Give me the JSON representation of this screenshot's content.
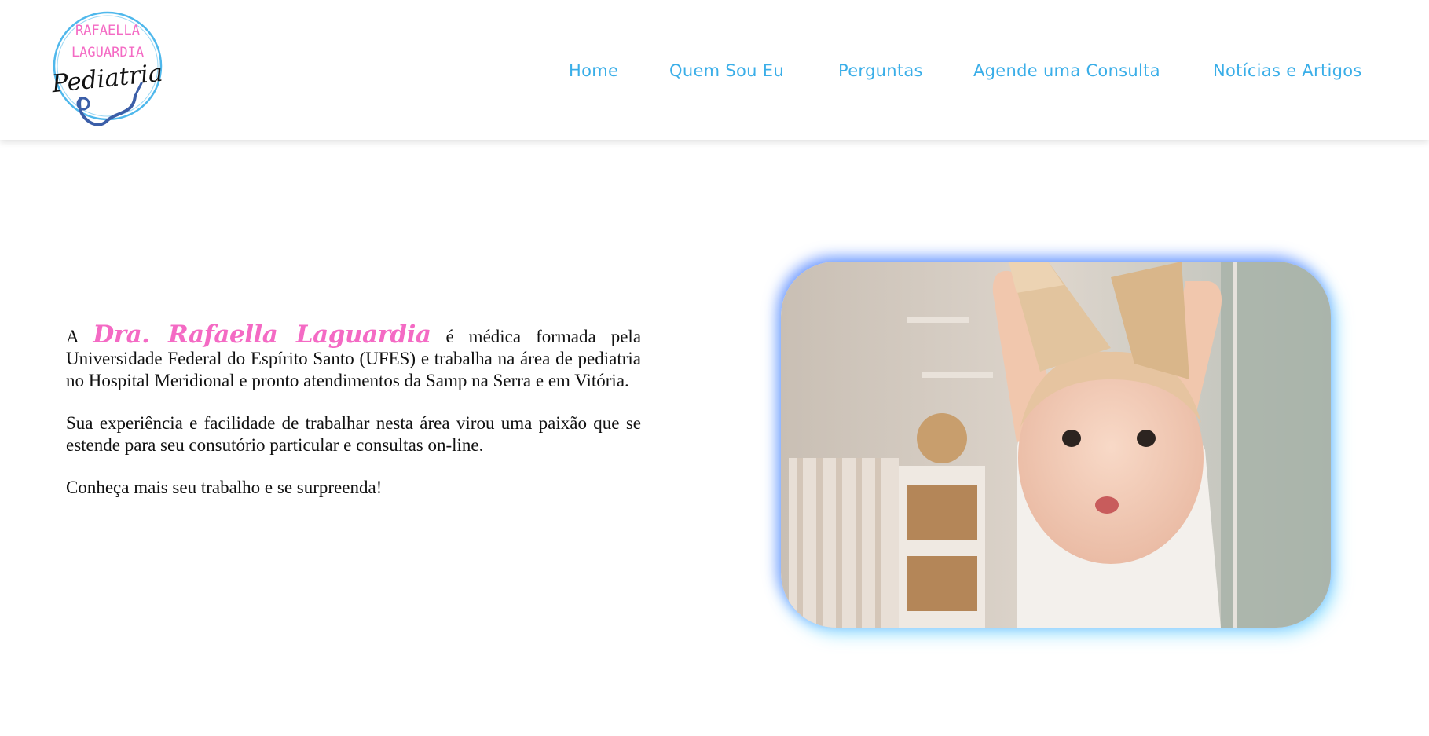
{
  "header": {
    "logo": {
      "line1": "RAFAELLA",
      "line2": "LAGUARDIA",
      "line3": "Pediatria"
    },
    "nav": [
      {
        "label": "Home"
      },
      {
        "label": "Quem Sou Eu"
      },
      {
        "label": "Perguntas"
      },
      {
        "label": "Agende uma Consulta"
      },
      {
        "label": "Notícias e Artigos"
      }
    ]
  },
  "intro": {
    "p1_prefix": "A",
    "p1_name": "Dra. Rafaella Laguardia",
    "p1_rest": "é médica formada pela Universidade Federal do Espírito Santo (UFES) e trabalha na área de pediatria no Hospital Meridional e pronto atendimentos da Samp na Serra e em Vitória.",
    "p2": "Sua experiência e facilidade de trabalhar nesta área virou uma paixão que se estende para seu consutório particular e consultas on-line.",
    "p3": "Conheça mais seu trabalho e se surpreenda!"
  },
  "colors": {
    "nav": "#3aaee8",
    "accent_pink": "#f46ac4",
    "logo_ring": "#4fb8ec",
    "photo_glow": "#4678ff"
  }
}
